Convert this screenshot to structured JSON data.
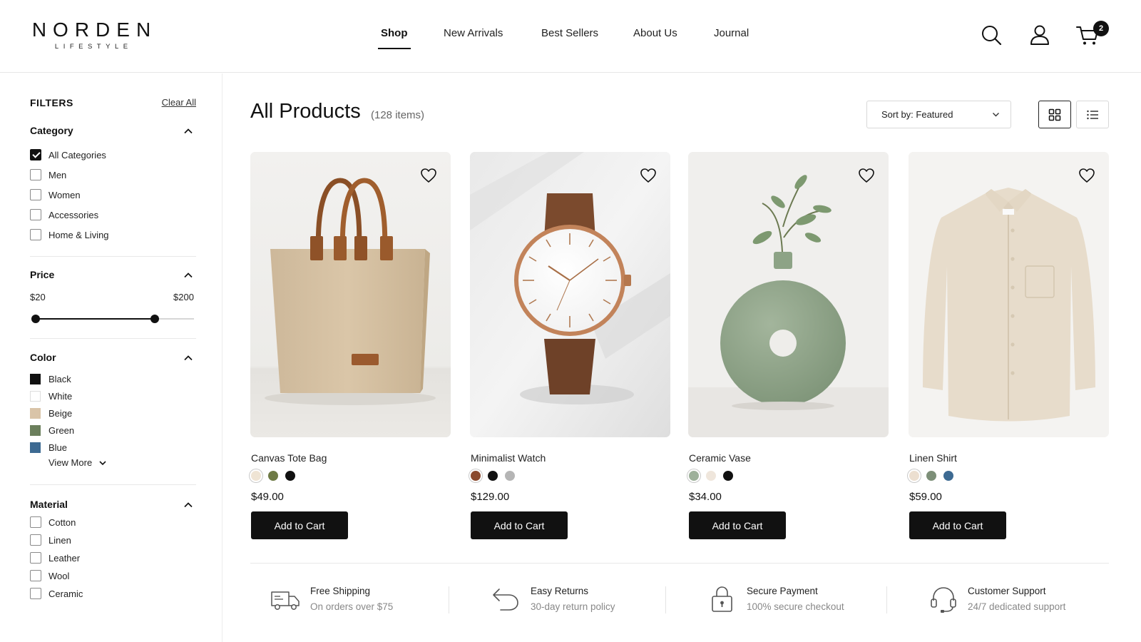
{
  "brand": {
    "name": "NORDEN",
    "tagline": "LIFESTYLE"
  },
  "nav": {
    "items": [
      {
        "label": "Shop",
        "active": true
      },
      {
        "label": "New Arrivals",
        "active": false
      },
      {
        "label": "Best Sellers",
        "active": false
      },
      {
        "label": "About Us",
        "active": false
      },
      {
        "label": "Journal",
        "active": false
      }
    ]
  },
  "header_icons": [
    "search-icon",
    "user-icon",
    "cart-icon"
  ],
  "cart": {
    "count": "2"
  },
  "filters": {
    "title": "FILTERS",
    "clear_label": "Clear All",
    "category": {
      "title": "Category",
      "options": [
        {
          "label": "All Categories",
          "checked": true
        },
        {
          "label": "Men",
          "checked": false
        },
        {
          "label": "Women",
          "checked": false
        },
        {
          "label": "Accessories",
          "checked": false
        },
        {
          "label": "Home & Living",
          "checked": false
        }
      ]
    },
    "price": {
      "title": "Price",
      "min_label": "$20",
      "max_label": "$200",
      "range_fill_fraction": 0.75
    },
    "color": {
      "title": "Color",
      "options": [
        {
          "label": "Black",
          "hex": "#111111"
        },
        {
          "label": "White",
          "hex": "#ffffff"
        },
        {
          "label": "Beige",
          "hex": "#d9c4a8"
        },
        {
          "label": "Green",
          "hex": "#6b7f5c"
        },
        {
          "label": "Blue",
          "hex": "#3d6a92"
        }
      ],
      "view_more": "View More"
    },
    "material": {
      "title": "Material",
      "options": [
        {
          "label": "Cotton",
          "checked": false
        },
        {
          "label": "Linen",
          "checked": false
        },
        {
          "label": "Leather",
          "checked": false
        },
        {
          "label": "Wool",
          "checked": false
        },
        {
          "label": "Ceramic",
          "checked": false
        }
      ]
    }
  },
  "main": {
    "title": "All Products",
    "count": "(128 items)",
    "sort_label": "Sort by: Featured",
    "view_modes": [
      "grid-view-icon",
      "list-view-icon"
    ]
  },
  "products": [
    {
      "name": "Canvas Tote Bag",
      "price": "$49.00",
      "button": "Add to Cart",
      "swatches": [
        "#efe4d4",
        "#6e7a45",
        "#111111"
      ],
      "image": "tote-bag"
    },
    {
      "name": "Minimalist Watch",
      "price": "$129.00",
      "button": "Add to Cart",
      "swatches": [
        "#8a4a2e",
        "#111111",
        "#b5b5b5"
      ],
      "image": "watch"
    },
    {
      "name": "Ceramic Vase",
      "price": "$34.00",
      "button": "Add to Cart",
      "swatches": [
        "#9db09a",
        "#efe6dc",
        "#111111"
      ],
      "image": "vase"
    },
    {
      "name": "Linen Shirt",
      "price": "$59.00",
      "button": "Add to Cart",
      "swatches": [
        "#ecdfd0",
        "#7d8f78",
        "#3d6a92"
      ],
      "image": "shirt"
    }
  ],
  "features": [
    {
      "title": "Free Shipping",
      "subtitle": "On orders over $75",
      "icon": "truck-icon"
    },
    {
      "title": "Easy Returns",
      "subtitle": "30-day return policy",
      "icon": "return-arrow-icon"
    },
    {
      "title": "Secure Payment",
      "subtitle": "100% secure checkout",
      "icon": "lock-icon"
    },
    {
      "title": "Customer Support",
      "subtitle": "24/7 dedicated support",
      "icon": "headset-icon"
    }
  ]
}
